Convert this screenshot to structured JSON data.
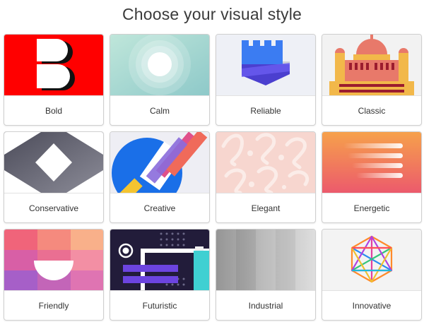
{
  "heading": "Choose your visual style",
  "styles": [
    {
      "label": "Bold"
    },
    {
      "label": "Calm"
    },
    {
      "label": "Reliable"
    },
    {
      "label": "Classic"
    },
    {
      "label": "Conservative"
    },
    {
      "label": "Creative"
    },
    {
      "label": "Elegant"
    },
    {
      "label": "Energetic"
    },
    {
      "label": "Friendly"
    },
    {
      "label": "Futuristic"
    },
    {
      "label": "Industrial"
    },
    {
      "label": "Innovative"
    }
  ]
}
